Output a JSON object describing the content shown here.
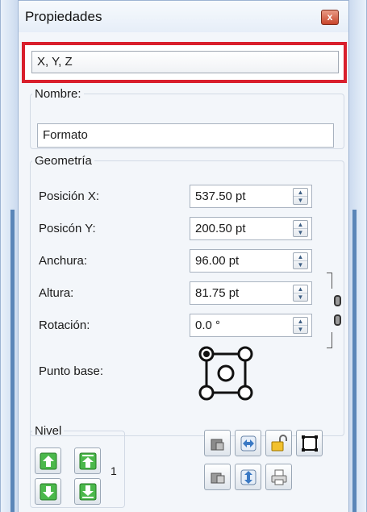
{
  "window": {
    "title": "Propiedades",
    "close_glyph": "x"
  },
  "object": {
    "name_field": "X, Y, Z",
    "highlight_color": "#d91f2c"
  },
  "nombre": {
    "legend": "Nombre:",
    "value": "Formato"
  },
  "geometria": {
    "legend": "Geometría",
    "rows": [
      {
        "label": "Posición X:",
        "value": "537.50 pt"
      },
      {
        "label": "Posicón Y:",
        "value": "200.50 pt"
      },
      {
        "label": "Anchura:",
        "value": "96.00 pt"
      },
      {
        "label": "Altura:",
        "value": "81.75 pt"
      },
      {
        "label": "Rotación:",
        "value": "0.0 °"
      }
    ],
    "base_point_label": "Punto base:"
  },
  "nivel": {
    "legend": "Nivel",
    "value": "1"
  },
  "icons": {
    "close": "close-icon",
    "spinner": "spinner-icon",
    "chain": "chain-link-icon",
    "base_point": "base-point-selector-icon",
    "level_buttons": [
      "raise-to-top-icon",
      "raise-one-level-icon",
      "lower-one-level-icon",
      "lower-to-bottom-icon"
    ],
    "toolbar": [
      "locked-object-icon",
      "flip-horizontal-icon",
      "unlock-icon",
      "selection-frame-icon",
      "unlock-object-icon",
      "flip-vertical-icon",
      "print-icon"
    ]
  },
  "colors": {
    "accent_blue": "#5b86b8",
    "level_green": "#3fae3f"
  }
}
